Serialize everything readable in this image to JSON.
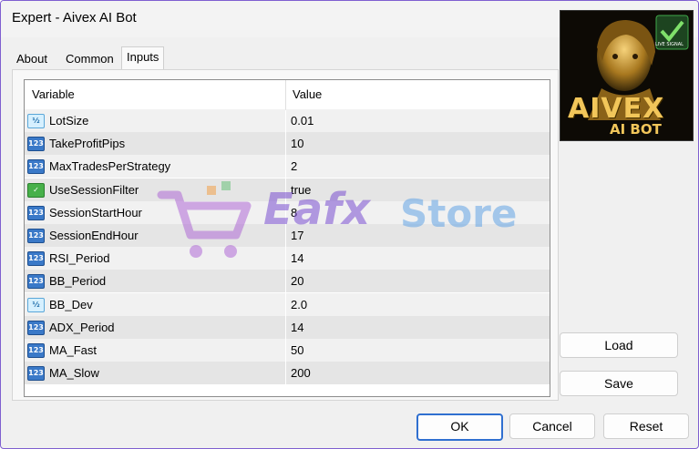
{
  "window": {
    "title": "Expert - Aivex AI Bot"
  },
  "tabs": [
    {
      "label": "About"
    },
    {
      "label": "Common"
    },
    {
      "label": "Inputs"
    }
  ],
  "grid": {
    "headers": {
      "variable": "Variable",
      "value": "Value"
    },
    "rows": [
      {
        "icon": "double-icon",
        "badge": "½",
        "name": "LotSize",
        "value": "0.01"
      },
      {
        "icon": "integer-icon",
        "badge": "123",
        "name": "TakeProfitPips",
        "value": "10"
      },
      {
        "icon": "integer-icon",
        "badge": "123",
        "name": "MaxTradesPerStrategy",
        "value": "2"
      },
      {
        "icon": "boolean-icon",
        "badge": "✓",
        "name": "UseSessionFilter",
        "value": "true"
      },
      {
        "icon": "integer-icon",
        "badge": "123",
        "name": "SessionStartHour",
        "value": "8"
      },
      {
        "icon": "integer-icon",
        "badge": "123",
        "name": "SessionEndHour",
        "value": "17"
      },
      {
        "icon": "integer-icon",
        "badge": "123",
        "name": "RSI_Period",
        "value": "14"
      },
      {
        "icon": "integer-icon",
        "badge": "123",
        "name": "BB_Period",
        "value": "20"
      },
      {
        "icon": "double-icon",
        "badge": "½",
        "name": "BB_Dev",
        "value": "2.0"
      },
      {
        "icon": "integer-icon",
        "badge": "123",
        "name": "ADX_Period",
        "value": "14"
      },
      {
        "icon": "integer-icon",
        "badge": "123",
        "name": "MA_Fast",
        "value": "50"
      },
      {
        "icon": "integer-icon",
        "badge": "123",
        "name": "MA_Slow",
        "value": "200"
      }
    ]
  },
  "logo": {
    "badge": "LIVE SIGNAL",
    "line1": "AIVEX",
    "line2": "AI BOT"
  },
  "watermark": {
    "part1": "Eafx",
    "part2": "Store"
  },
  "side_buttons": {
    "load": "Load",
    "save": "Save"
  },
  "footer_buttons": {
    "ok": "OK",
    "cancel": "Cancel",
    "reset": "Reset"
  },
  "colors": {
    "accent": "#2f6fd0",
    "window_border": "#7f5fd0",
    "row_alt": "#e5e5e5"
  }
}
